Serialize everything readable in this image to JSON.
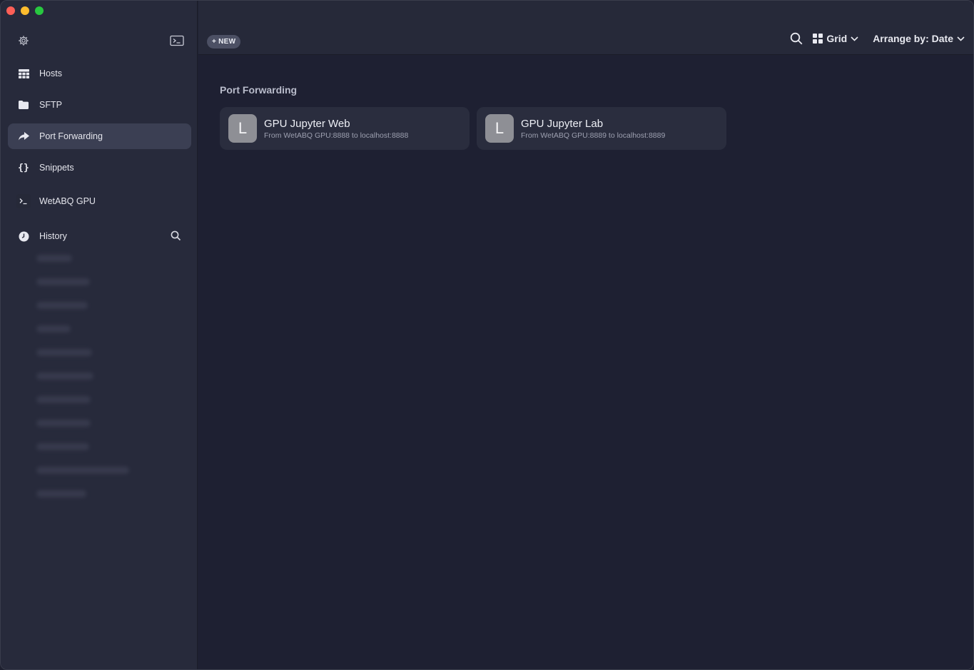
{
  "sidebar": {
    "items": [
      {
        "label": "Hosts",
        "icon": "hosts-grid-icon"
      },
      {
        "label": "SFTP",
        "icon": "folder-icon"
      },
      {
        "label": "Port Forwarding",
        "icon": "port-forward-icon",
        "active": true
      },
      {
        "label": "Snippets",
        "icon": "braces-icon"
      },
      {
        "label": "WetABQ GPU",
        "icon": "terminal-prompt-icon"
      },
      {
        "label": "History",
        "icon": "clock-icon"
      }
    ]
  },
  "toolbar": {
    "new_label": "NEW",
    "view_label": "Grid",
    "arrange_label": "Arrange by: Date"
  },
  "main": {
    "section_title": "Port Forwarding",
    "cards": [
      {
        "avatar": "L",
        "title": "GPU Jupyter Web",
        "subtitle": "From WetABQ GPU:8888 to localhost:8888"
      },
      {
        "avatar": "L",
        "title": "GPU Jupyter Lab",
        "subtitle": "From WetABQ GPU:8889 to localhost:8889"
      }
    ]
  },
  "colors": {
    "sidebar_bg": "#272a3b",
    "main_bg": "#1e2032",
    "active_item_bg": "#3b3f53",
    "card_bg": "#2a2d3e",
    "avatar_bg": "#8e8f95"
  }
}
